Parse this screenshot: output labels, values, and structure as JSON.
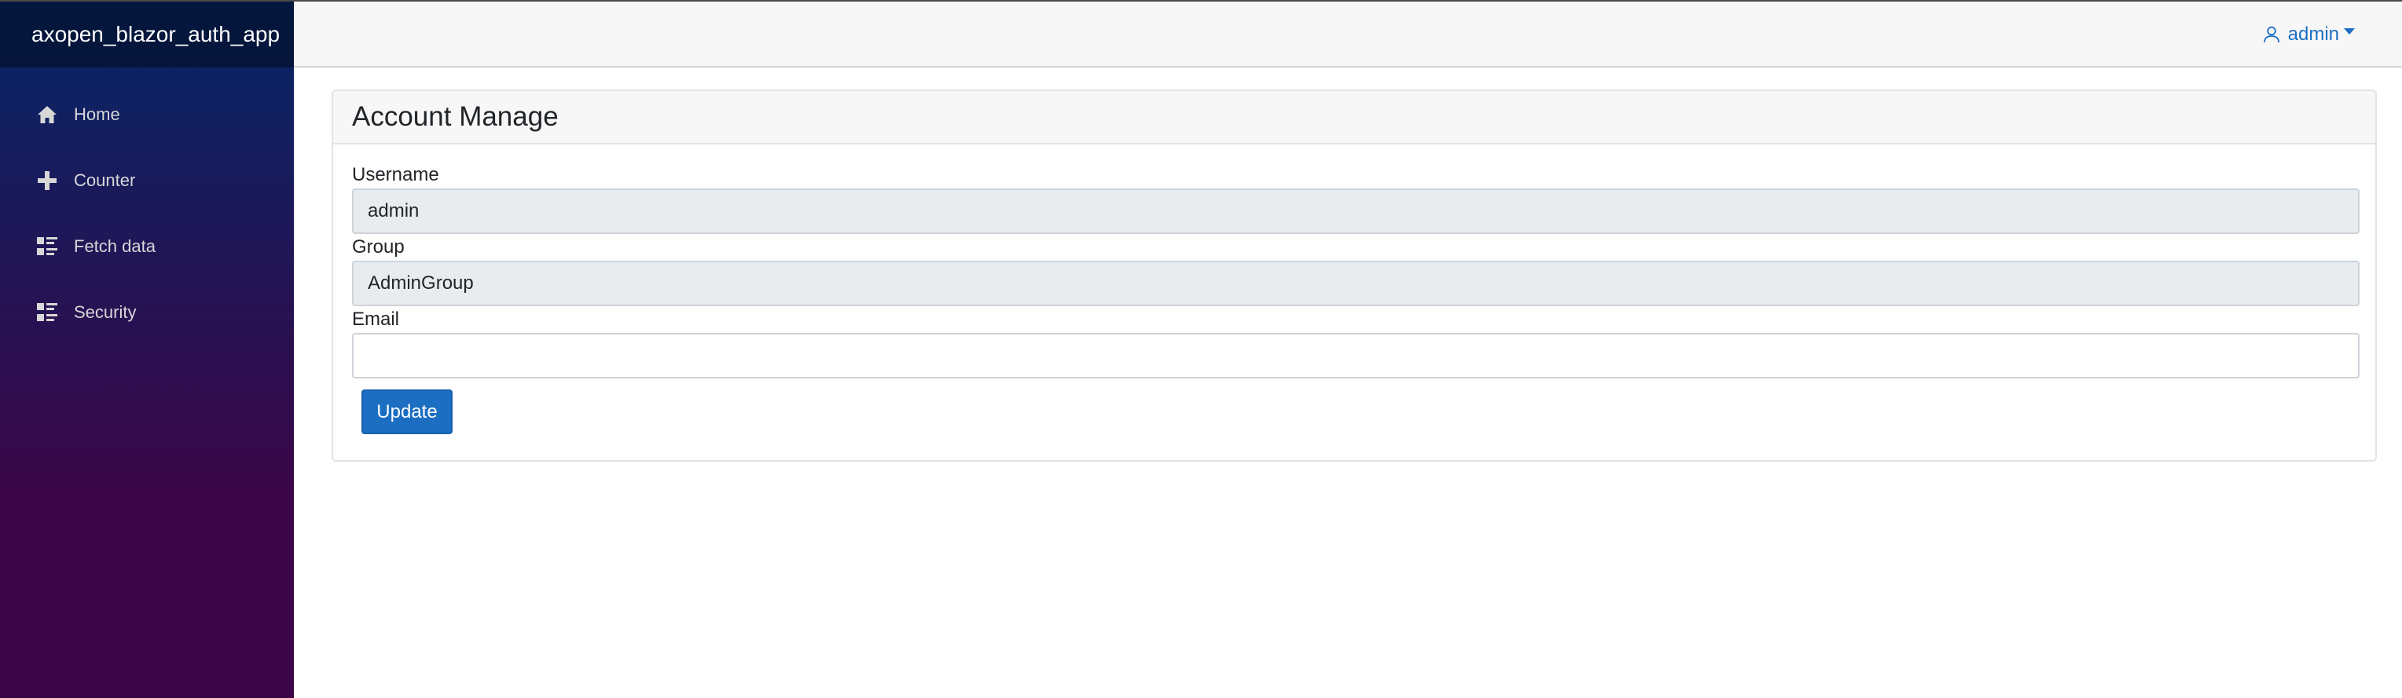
{
  "app": {
    "brand": "axopen_blazor_auth_app"
  },
  "sidebar": {
    "items": [
      {
        "label": "Home",
        "icon": "home-icon"
      },
      {
        "label": "Counter",
        "icon": "plus-icon"
      },
      {
        "label": "Fetch data",
        "icon": "list-rich-icon"
      },
      {
        "label": "Security",
        "icon": "list-rich-icon"
      }
    ]
  },
  "topbar": {
    "user_label": "admin",
    "user_icon": "person-icon"
  },
  "page": {
    "title": "Account Manage",
    "fields": {
      "username_label": "Username",
      "username_value": "admin",
      "group_label": "Group",
      "group_value": "AdminGroup",
      "email_label": "Email",
      "email_value": ""
    },
    "update_label": "Update"
  },
  "colors": {
    "sidebar_top": "#052767",
    "sidebar_bottom": "#3a0647",
    "accent": "#1b6ec2",
    "topbar_bg": "#f7f7f7",
    "readonly_bg": "#e9ecef"
  }
}
